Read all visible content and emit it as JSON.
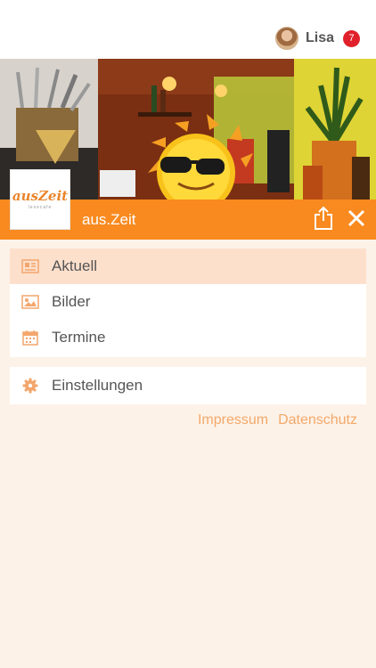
{
  "user": {
    "name": "Lisa",
    "notification_count": "7"
  },
  "venue": {
    "title": "aus.Zeit",
    "logo_word": "ausZeit",
    "logo_sub": "lesecafe"
  },
  "menu": {
    "items": [
      {
        "label": "Aktuell",
        "icon": "newspaper-icon",
        "active": true
      },
      {
        "label": "Bilder",
        "icon": "image-icon",
        "active": false
      },
      {
        "label": "Termine",
        "icon": "calendar-icon",
        "active": false
      }
    ],
    "settings": {
      "label": "Einstellungen",
      "icon": "gear-icon"
    }
  },
  "footer": {
    "impressum": "Impressum",
    "datenschutz": "Datenschutz"
  },
  "colors": {
    "accent": "#f88a1f",
    "background": "#fdf2e8",
    "active_item": "#fde0cc",
    "badge": "#e0202a",
    "link": "#f3a86a",
    "icon": "#f3a66c"
  }
}
